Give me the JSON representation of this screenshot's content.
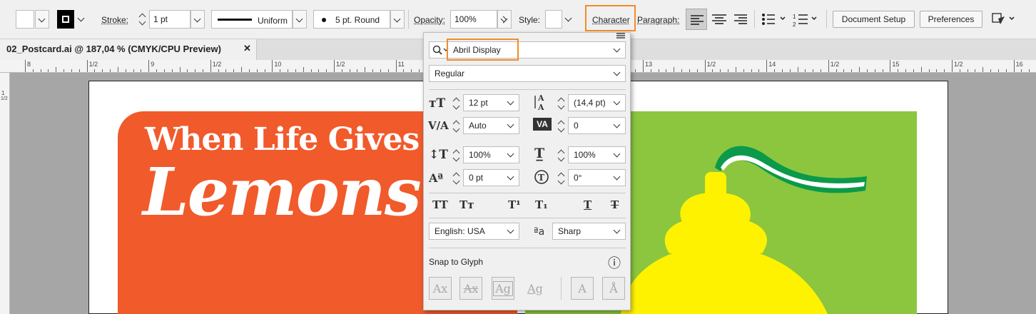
{
  "control_bar": {
    "stroke_label": "Stroke:",
    "stroke_value": "1 pt",
    "stroke_profile": "Uniform",
    "brush": "5 pt. Round",
    "opacity_label": "Opacity:",
    "opacity_value": "100%",
    "style_label": "Style:",
    "character_link": "Character",
    "paragraph_link": "Paragraph:",
    "document_setup": "Document Setup",
    "preferences": "Preferences"
  },
  "document_tab": {
    "title": "02_Postcard.ai @ 187,04 % (CMYK/CPU Preview)",
    "close": "✕"
  },
  "ruler": {
    "labels": [
      "8",
      "1/2",
      "9",
      "1/2",
      "10",
      "1/2",
      "11",
      "1/2",
      "12",
      "1/2",
      "13",
      "1/2",
      "14",
      "1/2",
      "15",
      "1/2",
      "16"
    ],
    "vertical_labels": [
      "1",
      "1/2"
    ]
  },
  "artwork": {
    "headline_top": "When Life Gives Y",
    "headline_bottom": "Lemons."
  },
  "character_panel": {
    "font_family": "Abril Display",
    "font_style": "Regular",
    "font_size": "12 pt",
    "leading": "(14,4 pt)",
    "kerning": "Auto",
    "tracking": "0",
    "vertical_scale": "100%",
    "horizontal_scale": "100%",
    "baseline_shift": "0 pt",
    "rotation": "0°",
    "language": "English: USA",
    "antialiasing": "Sharp",
    "snap_to_glyph": "Snap to Glyph",
    "info_icon": "ⓘ"
  },
  "colors": {
    "accent_highlight": "#f28c28",
    "orange_panel": "#f15a2b",
    "green_panel": "#8cc63f",
    "lemon": "#fff200",
    "ribbon": "#0a9a4a"
  }
}
